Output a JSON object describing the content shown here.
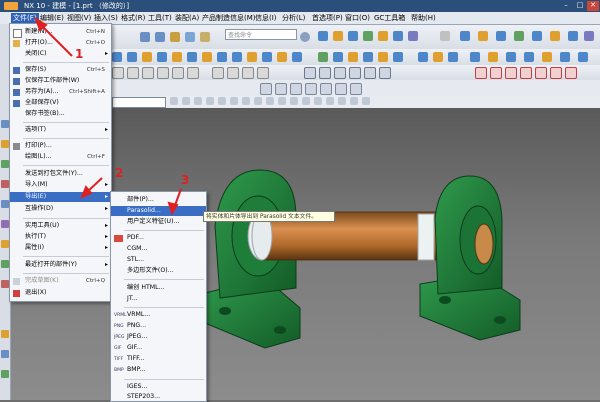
{
  "window": {
    "title": "NX 10 - 建模 - [1.prt （修改的）]"
  },
  "menubar": [
    {
      "label": "文件(F)",
      "active": true
    },
    {
      "label": "编辑(E)"
    },
    {
      "label": "视图(V)"
    },
    {
      "label": "插入(S)"
    },
    {
      "label": "格式(R)"
    },
    {
      "label": "工具(T)"
    },
    {
      "label": "装配(A)"
    },
    {
      "label": "产品制造信息(M)"
    },
    {
      "label": "信息(I)"
    },
    {
      "label": "分析(L)"
    },
    {
      "label": "首选项(P)"
    },
    {
      "label": "窗口(O)"
    },
    {
      "label": "GC工具箱"
    },
    {
      "label": "帮助(H)"
    }
  ],
  "toolbar": {
    "search_placeholder": "查找命令"
  },
  "file_menu": {
    "items": [
      {
        "label": "新建(N)...",
        "shortcut": "Ctrl+N"
      },
      {
        "label": "打开(O)...",
        "shortcut": "Ctrl+O"
      },
      {
        "label": "关闭(C)",
        "arrow": "▸"
      },
      {
        "label": "保存(S)",
        "shortcut": "Ctrl+S"
      },
      {
        "label": "仅保存工作部件(W)"
      },
      {
        "label": "另存为(A)...",
        "shortcut": "Ctrl+Shift+A"
      },
      {
        "label": "全部保存(V)"
      },
      {
        "label": "保存书签(B)..."
      },
      {
        "label": "选项(T)",
        "arrow": "▸"
      },
      {
        "label": "打印(P)..."
      },
      {
        "label": "绘图(L)...",
        "shortcut": "Ctrl+F"
      },
      {
        "label": "发送到打包文件(Y)..."
      },
      {
        "label": "导入(M)",
        "arrow": "▸"
      },
      {
        "label": "导出(E)",
        "arrow": "▸"
      },
      {
        "label": "互操作(D)",
        "arrow": "▸"
      },
      {
        "label": "实用工具(U)",
        "arrow": "▸"
      },
      {
        "label": "执行(T)",
        "arrow": "▸"
      },
      {
        "label": "属性(I)",
        "arrow": "▸"
      },
      {
        "label": "最近打开的部件(Y)",
        "arrow": "▸"
      },
      {
        "label": "完成草图(K)",
        "shortcut": "Ctrl+Q"
      },
      {
        "label": "退出(X)"
      }
    ]
  },
  "export_submenu": {
    "items": [
      {
        "label": "部件(P)..."
      },
      {
        "label": "Parasolid..."
      },
      {
        "label": "用户定义特征(U)..."
      },
      {
        "label": "PDF..."
      },
      {
        "label": "CGM..."
      },
      {
        "label": "STL..."
      },
      {
        "label": "多边形文件(O)..."
      },
      {
        "label": "编创 HTML..."
      },
      {
        "label": "JT..."
      },
      {
        "label": "VRML..."
      },
      {
        "label": "PNG..."
      },
      {
        "label": "JPEG..."
      },
      {
        "label": "GIF..."
      },
      {
        "label": "TIFF..."
      },
      {
        "label": "BMP..."
      },
      {
        "label": "IGES..."
      },
      {
        "label": "STEP203..."
      }
    ],
    "icon_labels": [
      "",
      "",
      "",
      "",
      "",
      "",
      "",
      "",
      "",
      "VRML",
      "PNG",
      "JPEG",
      "GIF",
      "TIFF",
      "BMP",
      "",
      ""
    ]
  },
  "tooltip": "将实体和片体导出到 Parasolid 文本文件。",
  "annotations": {
    "one": "1",
    "two": "2",
    "three": "3"
  },
  "colors": {
    "highlight": "#3a6dc4",
    "annotation": "#e02020",
    "model_green": "#1e7a3a",
    "shaft_brown": "#b8702e"
  }
}
